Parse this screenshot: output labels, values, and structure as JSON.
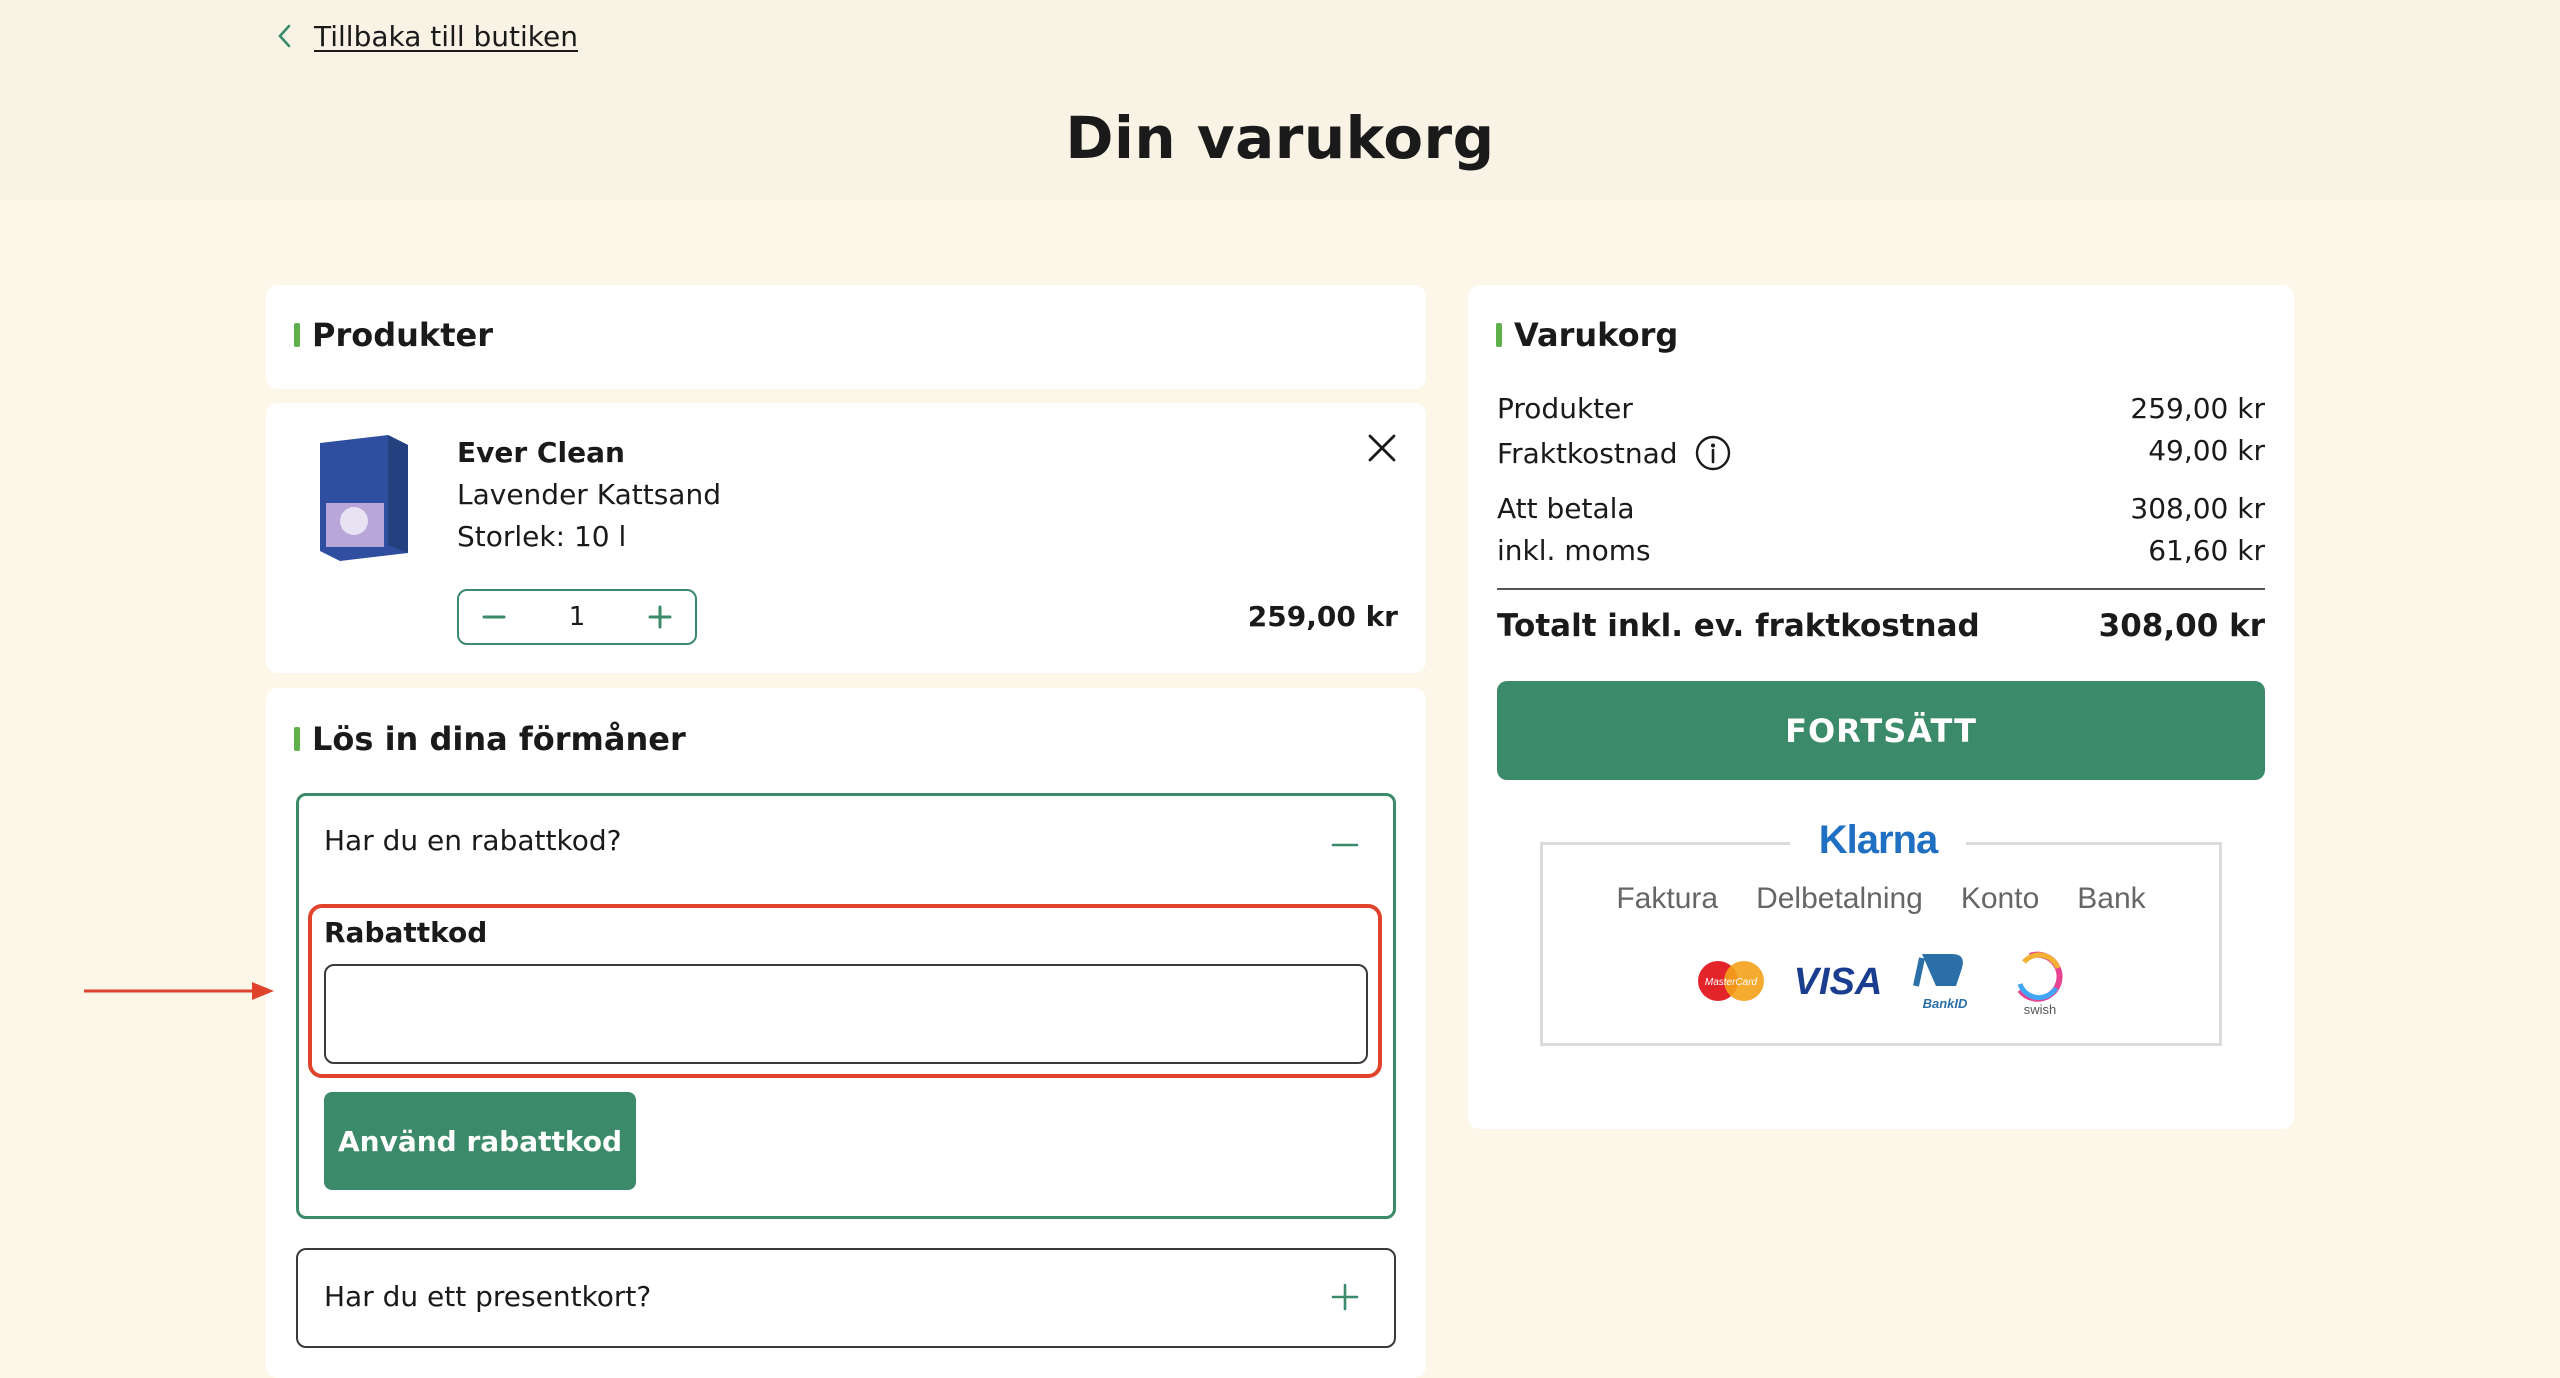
{
  "nav": {
    "back_label": "Tillbaka till butiken"
  },
  "page": {
    "title": "Din varukorg"
  },
  "products_section": {
    "title": "Produkter"
  },
  "product": {
    "brand": "Ever Clean",
    "name": "Lavender Kattsand",
    "size": "Storlek: 10 l",
    "quantity": "1",
    "price": "259,00 kr"
  },
  "benefits": {
    "title": "Lös in dina förmåner",
    "discount": {
      "question": "Har du en rabattkod?",
      "field_label": "Rabattkod",
      "input_value": "",
      "apply_label": "Använd rabattkod"
    },
    "giftcard": {
      "question": "Har du ett presentkort?"
    }
  },
  "summary": {
    "title": "Varukorg",
    "rows": [
      {
        "label": "Produkter",
        "value": "259,00 kr"
      },
      {
        "label": "Fraktkostnad",
        "value": "49,00 kr"
      },
      {
        "label": "Att betala",
        "value": "308,00 kr"
      },
      {
        "label": "inkl. moms",
        "value": "61,60 kr"
      }
    ],
    "total_label": "Totalt inkl. ev. fraktkostnad",
    "total_value": "308,00 kr",
    "continue_label": "FORTSÄTT"
  },
  "payment": {
    "provider": "Klarna",
    "methods": [
      "Faktura",
      "Delbetalning",
      "Konto",
      "Bank"
    ],
    "logos": [
      "MasterCard",
      "VISA",
      "BankID",
      "swish"
    ]
  },
  "colors": {
    "brand_green": "#3b8a6a",
    "accent_green": "#5fb04a",
    "highlight_red": "#e0432b",
    "background": "#fdf7e9"
  }
}
